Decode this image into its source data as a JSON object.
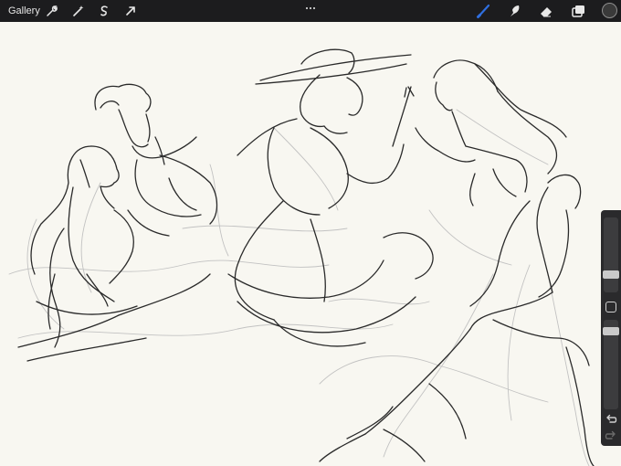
{
  "app": {
    "gallery_label": "Gallery"
  },
  "toolbar_left": {
    "icons": [
      "wrench-icon",
      "magic-wand-icon",
      "selection-icon",
      "transform-arrow-icon"
    ]
  },
  "toolbar_right": {
    "icons": [
      "brush-icon",
      "smudge-icon",
      "eraser-icon",
      "layers-icon"
    ],
    "active_tool": "brush",
    "active_color": "#2f6fe0",
    "current_color": "#3a3a3a"
  },
  "sidebar": {
    "brush_size_level": 0.3,
    "opacity_level": 0.2
  }
}
